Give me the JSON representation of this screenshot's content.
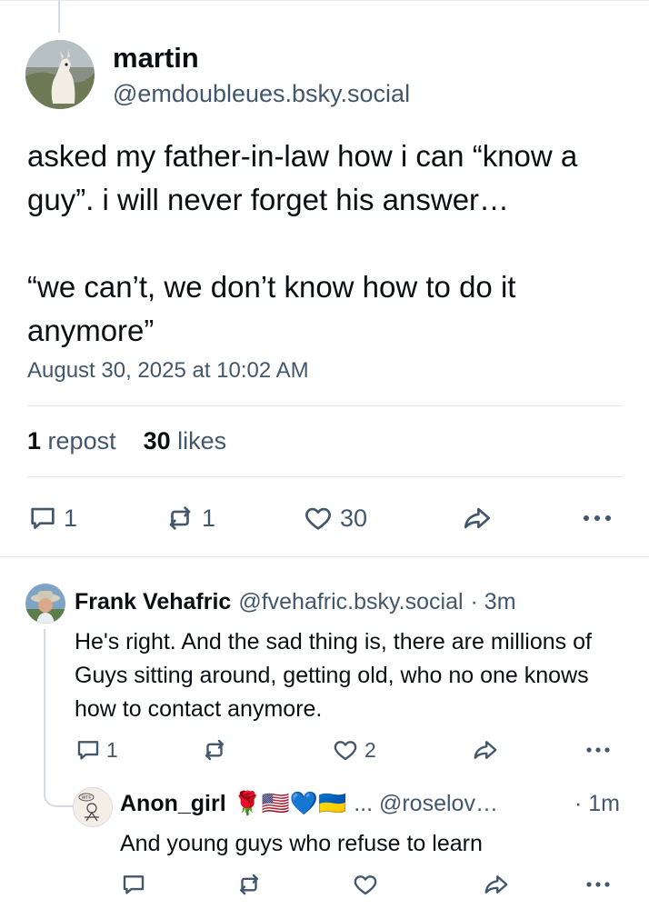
{
  "post": {
    "author_name": "martin",
    "author_handle": "@emdoubleues.bsky.social",
    "text": "asked my father-in-law how i can “know a guy”. i will never forget his answer…\n\n“we can’t, we don’t know how to do it anymore”",
    "timestamp": "August 30, 2025 at 10:02 AM",
    "repost_count": "1",
    "repost_label": "repost",
    "like_count": "30",
    "like_label": "likes",
    "actions": {
      "reply_count": "1",
      "repost_count": "1",
      "like_count": "30"
    }
  },
  "replies": [
    {
      "author_name": "Frank Vehafric",
      "author_handle": "@fvehafric.bsky.social",
      "time": "· 3m",
      "text": "He's right. And the sad thing is, there are millions of Guys sitting around, getting old, who no one knows how to contact anymore.",
      "reply_count": "1",
      "like_count": "2"
    },
    {
      "author_name": "Anon_girl",
      "author_emoji": "🌹🇺🇸💙🇺🇦",
      "author_handle": "... @roselov…",
      "time": "· 1m",
      "avatar_text": "WTF",
      "text": "And young guys who refuse to learn"
    }
  ],
  "colors": {
    "text": "#0b0f14",
    "muted": "#42576c",
    "divider": "#e3e8ec"
  }
}
